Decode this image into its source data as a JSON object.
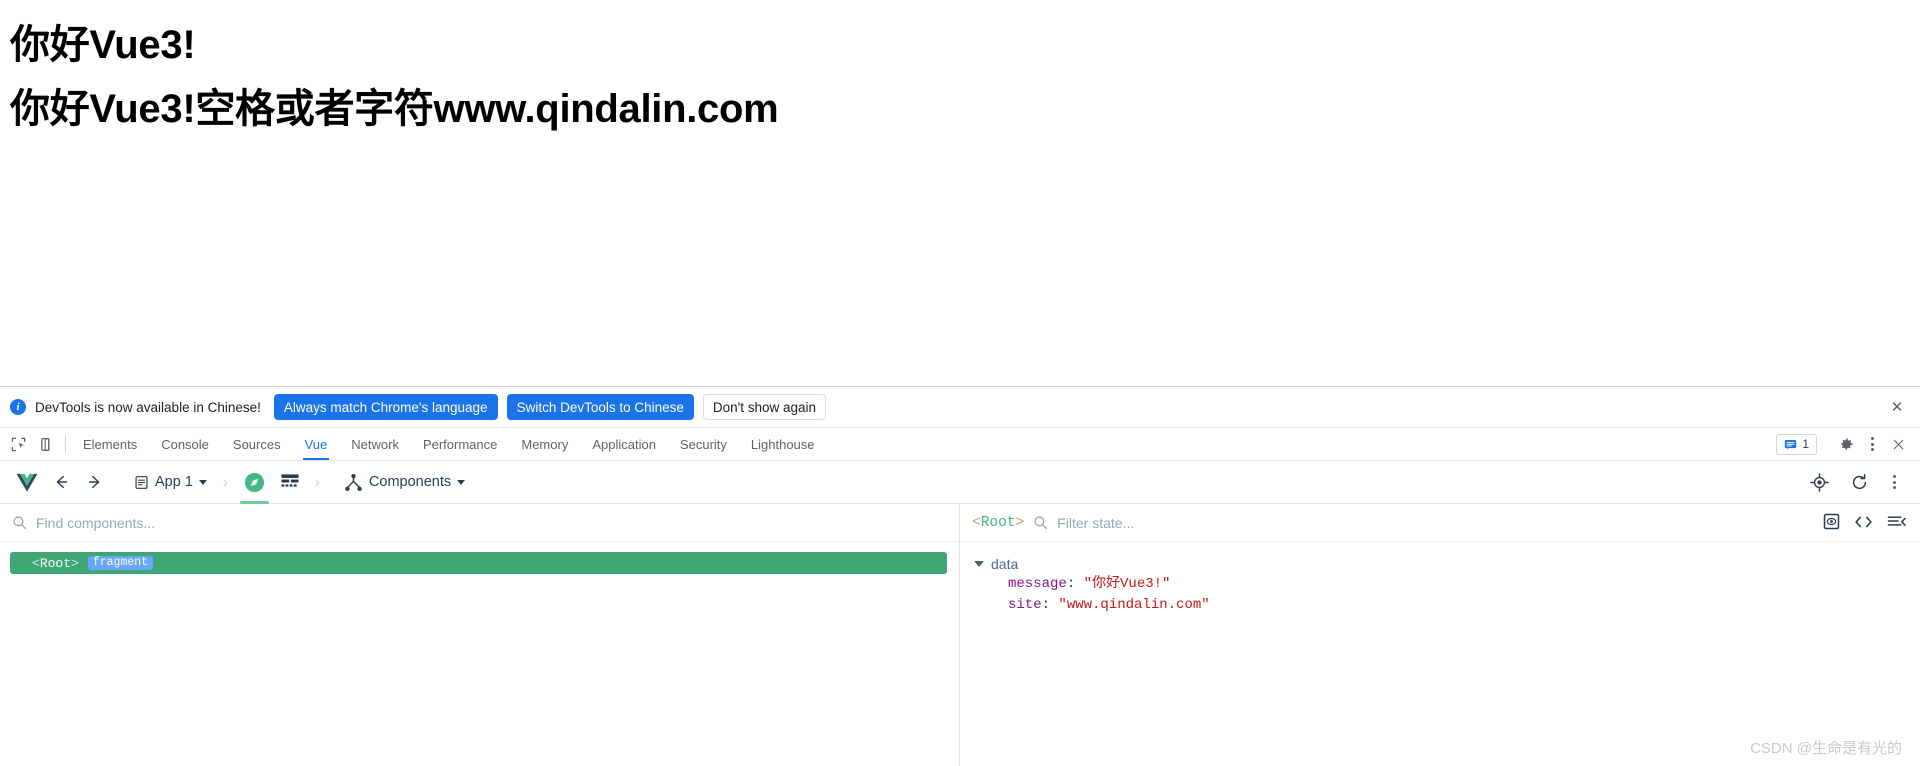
{
  "page": {
    "heading_1": "你好Vue3!",
    "heading_2": "你好Vue3!空格或者字符www.qindalin.com"
  },
  "infobar": {
    "icon": "info-icon",
    "message": "DevTools is now available in Chinese!",
    "buttons": [
      {
        "label": "Always match Chrome's language",
        "style": "primary"
      },
      {
        "label": "Switch DevTools to Chinese",
        "style": "primary"
      },
      {
        "label": "Don't show again",
        "style": "secondary"
      }
    ],
    "close_label": "✕"
  },
  "devtools_tabs": {
    "inspect_icon": "inspect-element-icon",
    "device_icon": "device-toolbar-icon",
    "items": [
      {
        "label": "Elements",
        "active": false
      },
      {
        "label": "Console",
        "active": false
      },
      {
        "label": "Sources",
        "active": false
      },
      {
        "label": "Vue",
        "active": true
      },
      {
        "label": "Network",
        "active": false
      },
      {
        "label": "Performance",
        "active": false
      },
      {
        "label": "Memory",
        "active": false
      },
      {
        "label": "Application",
        "active": false
      },
      {
        "label": "Security",
        "active": false
      },
      {
        "label": "Lighthouse",
        "active": false
      }
    ],
    "message_count": "1",
    "settings_icon": "gear-icon",
    "more_icon": "kebab-menu-icon",
    "close_icon": "close-icon"
  },
  "vue_toolbar": {
    "logo": "vue-logo-icon",
    "back_icon": "arrow-left-icon",
    "forward_icon": "arrow-right-icon",
    "app_selector_label": "App 1",
    "app_icon": "document-icon",
    "instance_icon": "compass-icon",
    "grid_icon": "grid-icon",
    "view_selector_label": "Components",
    "view_icon": "components-tree-icon",
    "select_icon": "target-select-icon",
    "refresh_icon": "refresh-icon",
    "more_icon": "kebab-menu-icon"
  },
  "tree_pane": {
    "search_icon": "search-icon",
    "search_placeholder": "Find components...",
    "search_value": "",
    "rows": [
      {
        "name": "<Root>",
        "open_angle": "<",
        "label": "Root",
        "close_angle": ">",
        "tag": "fragment",
        "selected": true
      }
    ]
  },
  "state_pane": {
    "root_open_angle": "<",
    "root_name": "Root",
    "root_close_angle": ">",
    "search_icon": "search-icon",
    "filter_placeholder": "Filter state...",
    "filter_value": "",
    "icons": {
      "inspect": "inspect-dom-icon",
      "code": "code-brackets-icon",
      "collapse": "collapse-all-icon"
    },
    "groups": [
      {
        "title": "data",
        "expanded": true,
        "entries": [
          {
            "key": "message",
            "value": "\"你好Vue3!\""
          },
          {
            "key": "site",
            "value": "\"www.qindalin.com\""
          }
        ]
      }
    ]
  },
  "watermark": "CSDN @生命是有光的",
  "colors": {
    "accent_blue": "#1a73e8",
    "vue_green": "#42b883",
    "selected_row_green": "#3fa776",
    "tag_blue": "#6aa6f7",
    "string_red": "#c41a16",
    "key_purple": "#881391"
  }
}
